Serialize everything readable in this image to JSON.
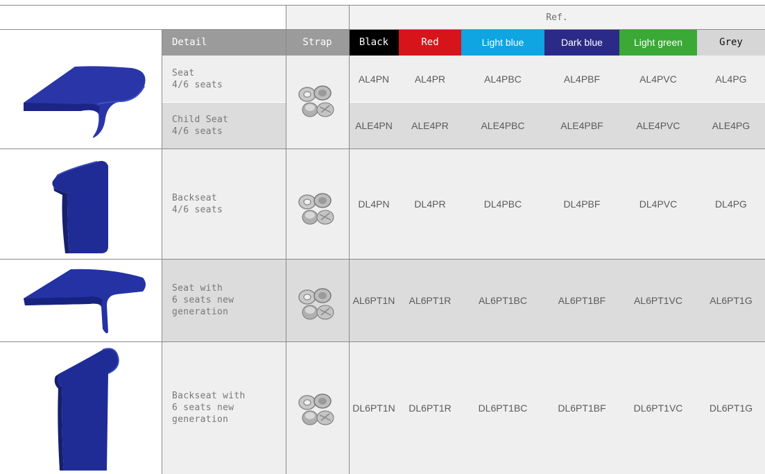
{
  "header": {
    "ref_label": "Ref.",
    "detail_label": "Detail",
    "strap_label": "Strap",
    "colors": [
      {
        "label": "Black",
        "bg": "#000000",
        "fg": "#ffffff"
      },
      {
        "label": "Red",
        "bg": "#d7141a",
        "fg": "#ffffff"
      },
      {
        "label": "Light blue",
        "bg": "#0ea5e2",
        "fg": "#ffffff"
      },
      {
        "label": "Dark blue",
        "bg": "#2b2a88",
        "fg": "#ffffff"
      },
      {
        "label": "Light green",
        "bg": "#3aa935",
        "fg": "#ffffff"
      },
      {
        "label": "Grey",
        "bg": "#d6d6d6",
        "fg": "#111111"
      }
    ]
  },
  "rows": [
    {
      "detail": "Seat\n4/6 seats",
      "refs": [
        "AL4PN",
        "AL4PR",
        "AL4PBC",
        "AL4PBF",
        "AL4PVC",
        "AL4PG"
      ]
    },
    {
      "detail": "Child Seat\n4/6 seats",
      "refs": [
        "ALE4PN",
        "ALE4PR",
        "ALE4PBC",
        "ALE4PBF",
        "ALE4PVC",
        "ALE4PG"
      ]
    },
    {
      "detail": "Backseat\n4/6 seats",
      "refs": [
        "DL4PN",
        "DL4PR",
        "DL4PBC",
        "DL4PBF",
        "DL4PVC",
        "DL4PG"
      ]
    },
    {
      "detail": "Seat with\n6 seats new\ngeneration",
      "refs": [
        "AL6PT1N",
        "AL6PT1R",
        "AL6PT1BC",
        "AL6PT1BF",
        "AL6PT1VC",
        "AL6PT1G"
      ]
    },
    {
      "detail": "Backseat with\n6 seats new\ngeneration",
      "refs": [
        "DL6PT1N",
        "DL6PT1R",
        "DL6PT1BC",
        "DL6PT1BF",
        "DL6PT1VC",
        "DL6PT1G"
      ]
    }
  ],
  "theme": {
    "header_gray": "#9b9b9b",
    "light_cell": "#efefef",
    "dark_cell": "#dcdcdc",
    "product_blue": "#2233a0"
  }
}
